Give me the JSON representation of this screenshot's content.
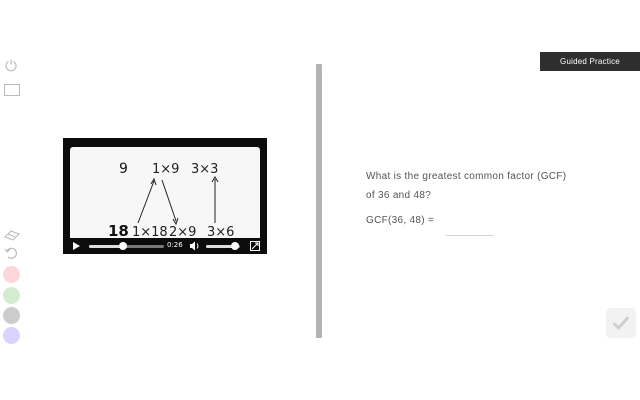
{
  "toolbar": {
    "tools": [
      "power-icon",
      "rectangle-icon",
      "eraser-icon",
      "undo-icon"
    ],
    "colors": [
      "#ffd6dc",
      "#d4ecd0",
      "#cccccc",
      "#d9d4ff"
    ]
  },
  "video": {
    "board_top": {
      "left_number": "9",
      "expr1": "1×9",
      "expr2": "3×3"
    },
    "board_bottom": {
      "left_number": "18",
      "expr1": "1×18",
      "expr2": "2×9",
      "expr3": "3×6"
    },
    "time": "0:26",
    "progress": 0.45,
    "volume": 0.85
  },
  "badge": {
    "label": "Guided Practice"
  },
  "question": {
    "text_line1": "What is the greatest common factor (GCF)",
    "text_line2": "of 36 and 48?",
    "answer_label": "GCF(36, 48) =",
    "answer_value": ""
  }
}
